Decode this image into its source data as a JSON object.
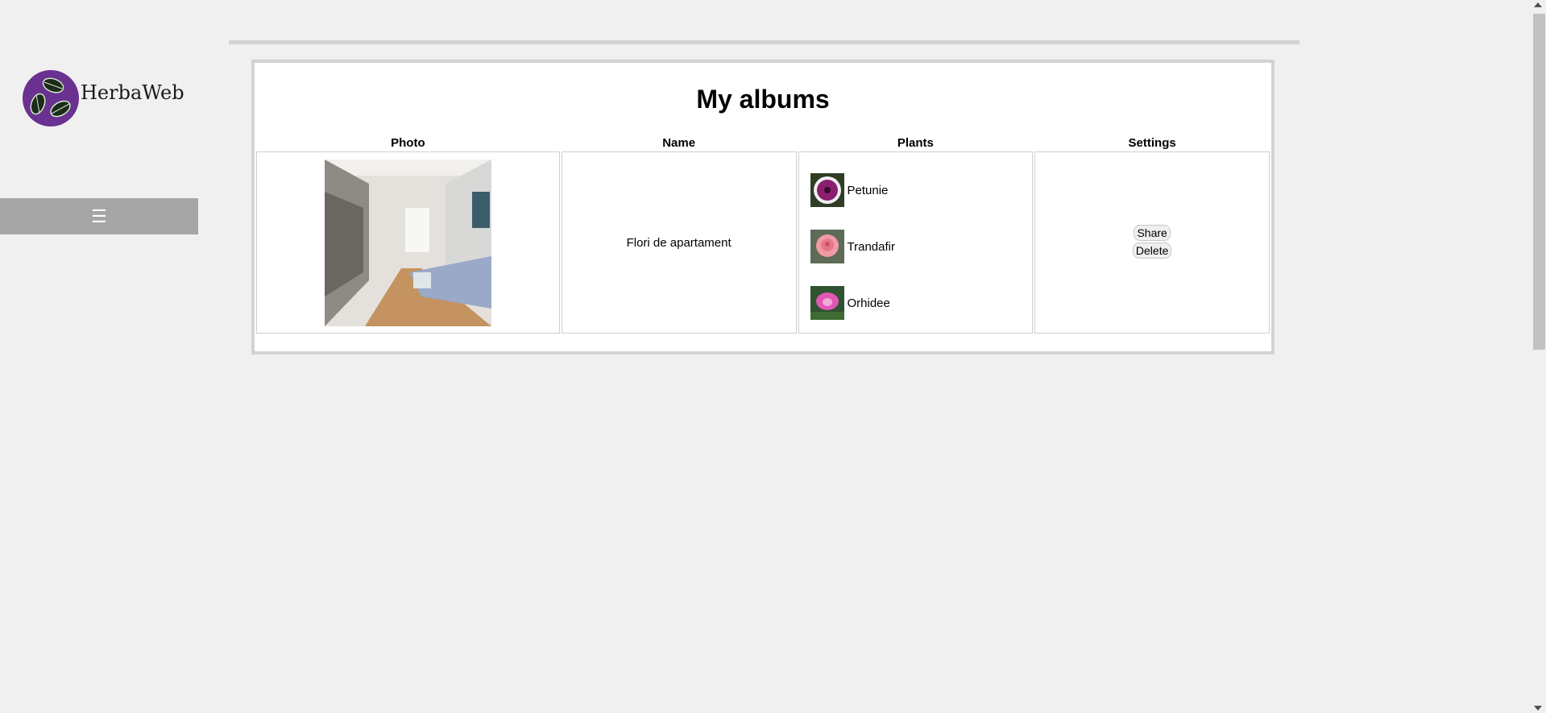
{
  "brand": {
    "name": "HerbaWeb",
    "logo_icon": "leaf-triskele-icon",
    "logo_color": "#6a3191"
  },
  "sidebar": {
    "menu_icon": "☰"
  },
  "page": {
    "title": "My albums"
  },
  "table": {
    "headers": {
      "photo": "Photo",
      "name": "Name",
      "plants": "Plants",
      "settings": "Settings"
    },
    "rows": [
      {
        "photo_alt": "apartment-living-room-photo",
        "name": "Flori de apartament",
        "plants": [
          {
            "name": "Petunie",
            "icon": "petunia-icon"
          },
          {
            "name": "Trandafir",
            "icon": "rose-icon"
          },
          {
            "name": "Orhidee",
            "icon": "orchid-icon"
          }
        ],
        "settings": {
          "share_label": "Share",
          "delete_label": "Delete"
        }
      }
    ]
  }
}
